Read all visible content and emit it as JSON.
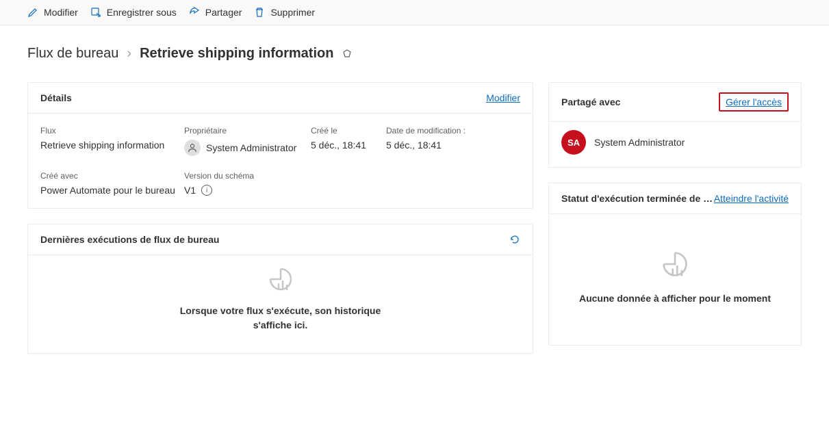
{
  "toolbar": {
    "edit": "Modifier",
    "save_as": "Enregistrer sous",
    "share": "Partager",
    "delete": "Supprimer"
  },
  "breadcrumb": {
    "root": "Flux de bureau",
    "current": "Retrieve shipping information"
  },
  "details": {
    "title": "Détails",
    "edit_link": "Modifier",
    "flow_label": "Flux",
    "flow_value": "Retrieve shipping information",
    "owner_label": "Propriétaire",
    "owner_value": "System Administrator",
    "created_label": "Créé le",
    "created_value": "5 déc., 18:41",
    "modified_label": "Date de modification :",
    "modified_value": "5 déc., 18:41",
    "created_with_label": "Créé avec",
    "created_with_value": "Power Automate pour le bureau",
    "schema_label": "Version du schéma",
    "schema_value": "V1"
  },
  "runs": {
    "title": "Dernières exécutions de flux de bureau",
    "empty_line1": "Lorsque votre flux s'exécute, son historique",
    "empty_line2": "s'affiche ici."
  },
  "shared": {
    "title": "Partagé avec",
    "manage_link": "Gérer l'accès",
    "user_initials": "SA",
    "user_name": "System Administrator"
  },
  "status": {
    "title": "Statut d'exécution terminée de …",
    "activity_link": "Atteindre l'activité",
    "empty": "Aucune donnée à afficher pour le moment"
  }
}
